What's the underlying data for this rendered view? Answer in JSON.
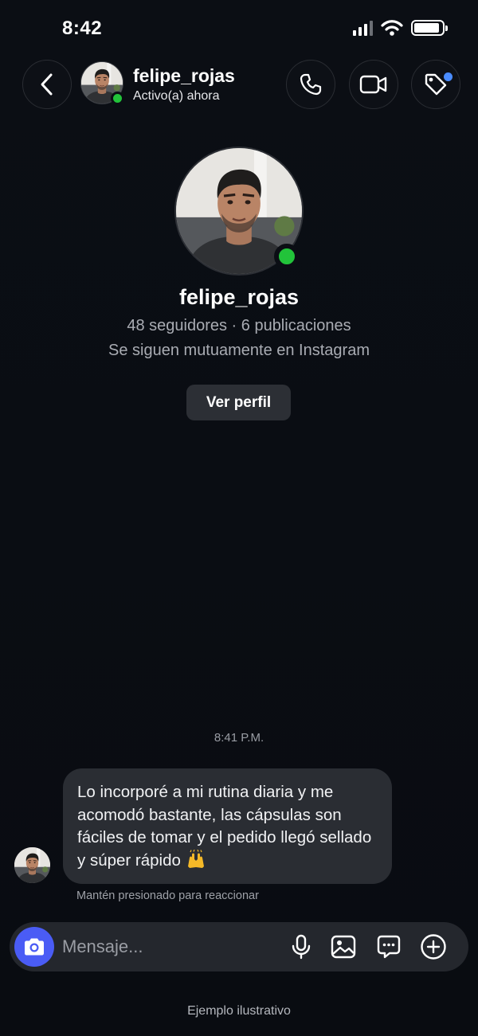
{
  "status_bar": {
    "time": "8:42",
    "battery_level": 0.9
  },
  "header": {
    "username": "felipe_rojas",
    "status": "Activo(a) ahora",
    "icons": {
      "back": "chevron-left-icon",
      "call": "phone-icon",
      "video": "video-camera-icon",
      "tag": "tag-icon"
    }
  },
  "profile": {
    "username": "felipe_rojas",
    "stats": "48 seguidores · 6 publicaciones",
    "mutual": "Se siguen mutuamente en Instagram",
    "view_profile_label": "Ver perfil"
  },
  "conversation": {
    "timestamp": "8:41 P.M.",
    "messages": [
      {
        "text": "Lo incorporé a mi rutina diaria y me acomodó bastante, las cápsulas son fáciles de tomar y el pedido llegó sellado y súper rápido",
        "emoji": "raising-hands-emoji"
      }
    ],
    "react_hint": "Mantén presionado para reaccionar"
  },
  "composer": {
    "placeholder": "Mensaje...",
    "icons": [
      "camera-icon",
      "microphone-icon",
      "gallery-icon",
      "sticker-icon",
      "plus-icon"
    ]
  },
  "footer": {
    "note": "Ejemplo ilustrativo"
  },
  "colors": {
    "online": "#22c33a",
    "accent_blue": "#4a5cf5",
    "notification_dot": "#4a8cff",
    "bubble": "#2a2d33"
  }
}
